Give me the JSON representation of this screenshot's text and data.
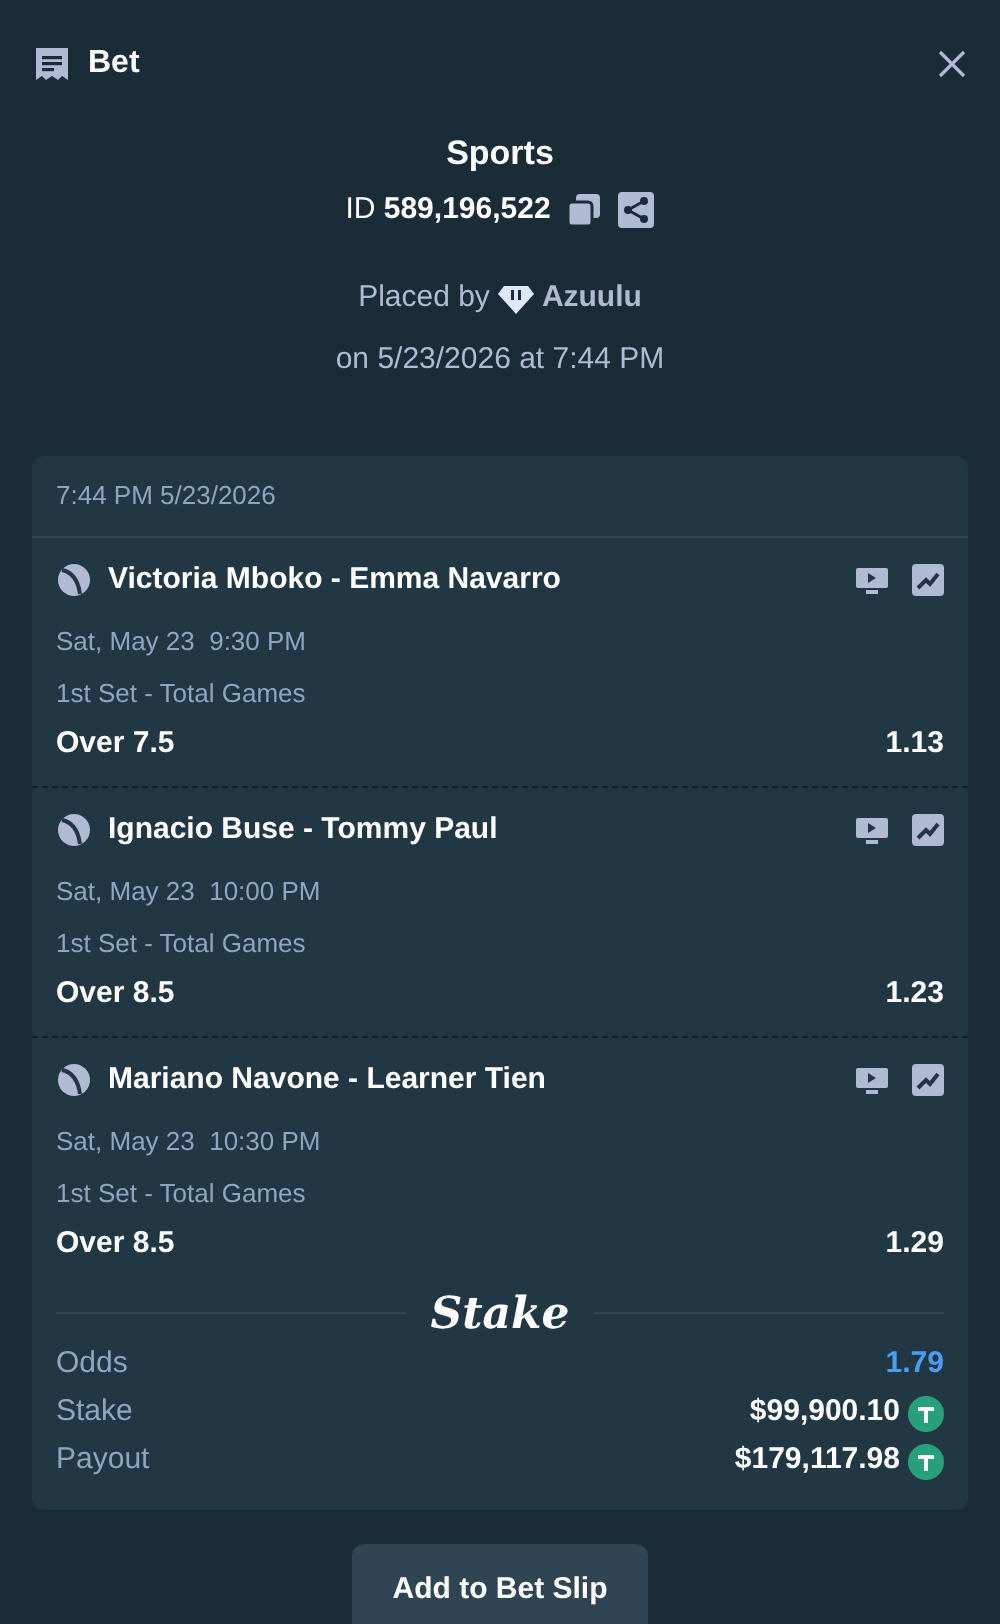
{
  "header": {
    "title": "Bet"
  },
  "bet": {
    "category": "Sports",
    "id_label": "ID",
    "id": "589,196,522",
    "placed_by_label": "Placed by",
    "user": "Azuulu",
    "placed_on": "on 5/23/2026 at 7:44 PM"
  },
  "card": {
    "timestamp": "7:44 PM 5/23/2026",
    "legs": [
      {
        "match": "Victoria Mboko - Emma Navarro",
        "time": "Sat, May 23  9:30 PM",
        "market": "1st Set - Total Games",
        "outcome": "Over 7.5",
        "odds": "1.13"
      },
      {
        "match": "Ignacio Buse - Tommy Paul",
        "time": "Sat, May 23  10:00 PM",
        "market": "1st Set - Total Games",
        "outcome": "Over 8.5",
        "odds": "1.23"
      },
      {
        "match": "Mariano Navone - Learner Tien",
        "time": "Sat, May 23  10:30 PM",
        "market": "1st Set - Total Games",
        "outcome": "Over 8.5",
        "odds": "1.29"
      }
    ],
    "logo": "Stake",
    "summary": [
      {
        "label": "Odds",
        "value": "1.79",
        "kind": "odds"
      },
      {
        "label": "Stake",
        "value": "$99,900.10",
        "kind": "amount"
      },
      {
        "label": "Payout",
        "value": "$179,117.98",
        "kind": "amount"
      }
    ]
  },
  "button": "Add to Bet Slip"
}
